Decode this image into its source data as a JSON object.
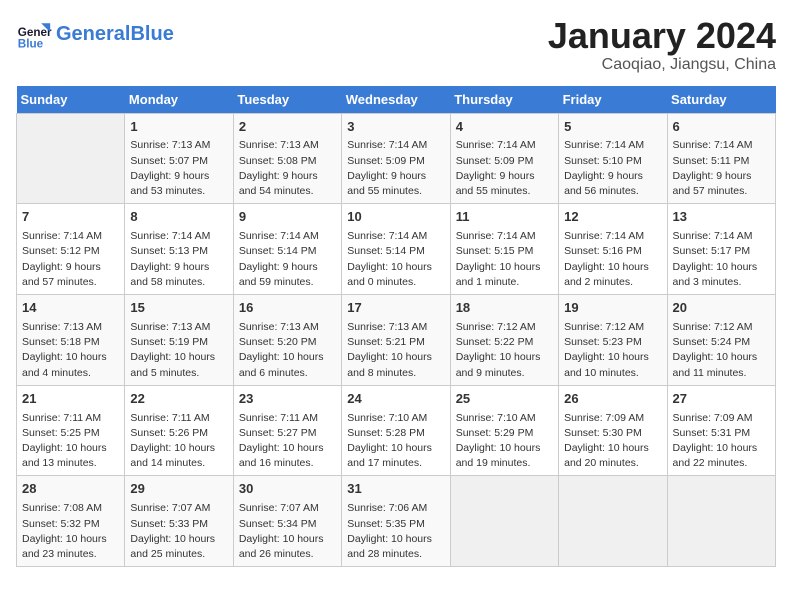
{
  "header": {
    "logo_general": "General",
    "logo_blue": "Blue",
    "month_title": "January 2024",
    "location": "Caoqiao, Jiangsu, China"
  },
  "calendar": {
    "days_of_week": [
      "Sunday",
      "Monday",
      "Tuesday",
      "Wednesday",
      "Thursday",
      "Friday",
      "Saturday"
    ],
    "weeks": [
      [
        {
          "day": "",
          "info": ""
        },
        {
          "day": "1",
          "info": "Sunrise: 7:13 AM\nSunset: 5:07 PM\nDaylight: 9 hours\nand 53 minutes."
        },
        {
          "day": "2",
          "info": "Sunrise: 7:13 AM\nSunset: 5:08 PM\nDaylight: 9 hours\nand 54 minutes."
        },
        {
          "day": "3",
          "info": "Sunrise: 7:14 AM\nSunset: 5:09 PM\nDaylight: 9 hours\nand 55 minutes."
        },
        {
          "day": "4",
          "info": "Sunrise: 7:14 AM\nSunset: 5:09 PM\nDaylight: 9 hours\nand 55 minutes."
        },
        {
          "day": "5",
          "info": "Sunrise: 7:14 AM\nSunset: 5:10 PM\nDaylight: 9 hours\nand 56 minutes."
        },
        {
          "day": "6",
          "info": "Sunrise: 7:14 AM\nSunset: 5:11 PM\nDaylight: 9 hours\nand 57 minutes."
        }
      ],
      [
        {
          "day": "7",
          "info": "Sunrise: 7:14 AM\nSunset: 5:12 PM\nDaylight: 9 hours\nand 57 minutes."
        },
        {
          "day": "8",
          "info": "Sunrise: 7:14 AM\nSunset: 5:13 PM\nDaylight: 9 hours\nand 58 minutes."
        },
        {
          "day": "9",
          "info": "Sunrise: 7:14 AM\nSunset: 5:14 PM\nDaylight: 9 hours\nand 59 minutes."
        },
        {
          "day": "10",
          "info": "Sunrise: 7:14 AM\nSunset: 5:14 PM\nDaylight: 10 hours\nand 0 minutes."
        },
        {
          "day": "11",
          "info": "Sunrise: 7:14 AM\nSunset: 5:15 PM\nDaylight: 10 hours\nand 1 minute."
        },
        {
          "day": "12",
          "info": "Sunrise: 7:14 AM\nSunset: 5:16 PM\nDaylight: 10 hours\nand 2 minutes."
        },
        {
          "day": "13",
          "info": "Sunrise: 7:14 AM\nSunset: 5:17 PM\nDaylight: 10 hours\nand 3 minutes."
        }
      ],
      [
        {
          "day": "14",
          "info": "Sunrise: 7:13 AM\nSunset: 5:18 PM\nDaylight: 10 hours\nand 4 minutes."
        },
        {
          "day": "15",
          "info": "Sunrise: 7:13 AM\nSunset: 5:19 PM\nDaylight: 10 hours\nand 5 minutes."
        },
        {
          "day": "16",
          "info": "Sunrise: 7:13 AM\nSunset: 5:20 PM\nDaylight: 10 hours\nand 6 minutes."
        },
        {
          "day": "17",
          "info": "Sunrise: 7:13 AM\nSunset: 5:21 PM\nDaylight: 10 hours\nand 8 minutes."
        },
        {
          "day": "18",
          "info": "Sunrise: 7:12 AM\nSunset: 5:22 PM\nDaylight: 10 hours\nand 9 minutes."
        },
        {
          "day": "19",
          "info": "Sunrise: 7:12 AM\nSunset: 5:23 PM\nDaylight: 10 hours\nand 10 minutes."
        },
        {
          "day": "20",
          "info": "Sunrise: 7:12 AM\nSunset: 5:24 PM\nDaylight: 10 hours\nand 11 minutes."
        }
      ],
      [
        {
          "day": "21",
          "info": "Sunrise: 7:11 AM\nSunset: 5:25 PM\nDaylight: 10 hours\nand 13 minutes."
        },
        {
          "day": "22",
          "info": "Sunrise: 7:11 AM\nSunset: 5:26 PM\nDaylight: 10 hours\nand 14 minutes."
        },
        {
          "day": "23",
          "info": "Sunrise: 7:11 AM\nSunset: 5:27 PM\nDaylight: 10 hours\nand 16 minutes."
        },
        {
          "day": "24",
          "info": "Sunrise: 7:10 AM\nSunset: 5:28 PM\nDaylight: 10 hours\nand 17 minutes."
        },
        {
          "day": "25",
          "info": "Sunrise: 7:10 AM\nSunset: 5:29 PM\nDaylight: 10 hours\nand 19 minutes."
        },
        {
          "day": "26",
          "info": "Sunrise: 7:09 AM\nSunset: 5:30 PM\nDaylight: 10 hours\nand 20 minutes."
        },
        {
          "day": "27",
          "info": "Sunrise: 7:09 AM\nSunset: 5:31 PM\nDaylight: 10 hours\nand 22 minutes."
        }
      ],
      [
        {
          "day": "28",
          "info": "Sunrise: 7:08 AM\nSunset: 5:32 PM\nDaylight: 10 hours\nand 23 minutes."
        },
        {
          "day": "29",
          "info": "Sunrise: 7:07 AM\nSunset: 5:33 PM\nDaylight: 10 hours\nand 25 minutes."
        },
        {
          "day": "30",
          "info": "Sunrise: 7:07 AM\nSunset: 5:34 PM\nDaylight: 10 hours\nand 26 minutes."
        },
        {
          "day": "31",
          "info": "Sunrise: 7:06 AM\nSunset: 5:35 PM\nDaylight: 10 hours\nand 28 minutes."
        },
        {
          "day": "",
          "info": ""
        },
        {
          "day": "",
          "info": ""
        },
        {
          "day": "",
          "info": ""
        }
      ]
    ]
  }
}
